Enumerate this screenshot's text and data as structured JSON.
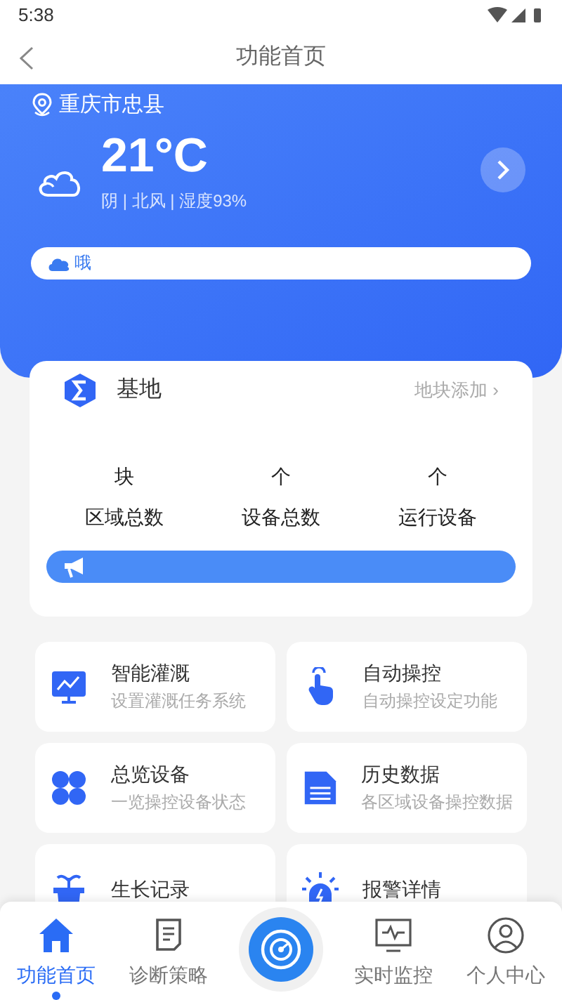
{
  "status_bar": {
    "time": "5:38"
  },
  "header": {
    "title": "功能首页"
  },
  "weather": {
    "location": "重庆市忠县",
    "temperature": "21°C",
    "detail": "阴 | 北风 | 湿度93%",
    "ticker": "哦"
  },
  "base_card": {
    "title": "基地",
    "action": "地块添加 ›",
    "stats": [
      {
        "unit": "块",
        "label": "区域总数"
      },
      {
        "unit": "个",
        "label": "设备总数"
      },
      {
        "unit": "个",
        "label": "运行设备"
      }
    ]
  },
  "features": [
    {
      "kind": "chart",
      "title": "智能灌溉",
      "subtitle": "设置灌溉任务系统"
    },
    {
      "kind": "hand",
      "title": "自动操控",
      "subtitle": "自动操控设定功能"
    },
    {
      "kind": "grid",
      "title": "总览设备",
      "subtitle": "一览操控设备状态"
    },
    {
      "kind": "document",
      "title": "历史数据",
      "subtitle": "各区域设备操控数据"
    },
    {
      "kind": "plant",
      "title": "生长记录"
    },
    {
      "kind": "alarm",
      "title": "报警详情"
    }
  ],
  "tab_bar": [
    {
      "kind": "home",
      "label": "功能首页",
      "selected": true
    },
    {
      "kind": "note",
      "label": "诊断策略",
      "selected": false
    },
    {
      "kind": "center"
    },
    {
      "kind": "monitor",
      "label": "实时监控",
      "selected": false
    },
    {
      "kind": "person",
      "label": "个人中心",
      "selected": false
    }
  ]
}
